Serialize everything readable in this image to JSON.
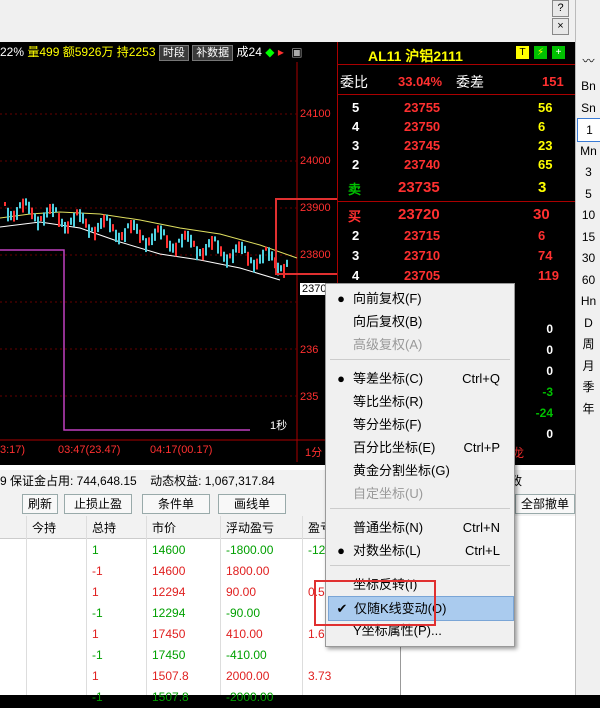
{
  "title_strip": {
    "help_btn": "?",
    "close_btn": "×"
  },
  "info_bar": {
    "pct": "22%",
    "volume": "量499",
    "amount": "额5926万",
    "hold": "持2253",
    "tag_period": "时段",
    "tag_supplement": "补数据",
    "suffix": "成24"
  },
  "chart": {
    "price_labels": [
      "24100",
      "24000",
      "23900",
      "23800",
      "2370",
      "236",
      "235"
    ],
    "time_labels": [
      "3:17)",
      "03:47(23.47)",
      "04:17(00.17)",
      "1分"
    ],
    "cursor_label": "1秒"
  },
  "orderbook": {
    "symbol": "AL11 沪铝2111",
    "commission_ratio_label": "委比",
    "commission_ratio": "33.04%",
    "commission_diff_label": "委差",
    "commission_diff": "151",
    "sell_rows": [
      {
        "level": "5",
        "price": "23755",
        "vol": "56"
      },
      {
        "level": "4",
        "price": "23750",
        "vol": "6"
      },
      {
        "level": "3",
        "price": "23745",
        "vol": "23"
      },
      {
        "level": "2",
        "price": "23740",
        "vol": "65"
      }
    ],
    "sell1": {
      "label": "卖",
      "price": "23735",
      "vol": "3"
    },
    "buy1": {
      "label": "买",
      "price": "23720",
      "vol": "30"
    },
    "buy_rows": [
      {
        "level": "2",
        "price": "23715",
        "vol": "6"
      },
      {
        "level": "3",
        "price": "23710",
        "vol": "74"
      },
      {
        "level": "4",
        "price": "23705",
        "vol": "119"
      }
    ],
    "right_values": [
      "0",
      "0",
      "0",
      "-3",
      "-24",
      "0"
    ],
    "footer": "成交龙"
  },
  "status": {
    "margin": "9  保证金占用: 744,648.15",
    "dynamic_equity": "动态权益: 1,067,317.84",
    "cancel_all": "全部撤单",
    "side_label": "致"
  },
  "buttons": [
    "刷新",
    "止损止盈",
    "条件单",
    "画线单"
  ],
  "table": {
    "headers": [
      "今持",
      "总持",
      "市价",
      "浮动盈亏",
      "盈亏"
    ],
    "rows": [
      {
        "total": "1",
        "price": "14600",
        "float_pl": "-1800.00",
        "pl": "-12",
        "color": "green"
      },
      {
        "total": "-1",
        "price": "14600",
        "float_pl": "1800.00",
        "pl": "",
        "color": "red"
      },
      {
        "total": "1",
        "price": "12294",
        "float_pl": "90.00",
        "pl": "0.5",
        "color": "red"
      },
      {
        "total": "-1",
        "price": "12294",
        "float_pl": "-90.00",
        "pl": "",
        "color": "green"
      },
      {
        "total": "1",
        "price": "17450",
        "float_pl": "410.00",
        "pl": "1.6",
        "color": "red"
      },
      {
        "total": "-1",
        "price": "17450",
        "float_pl": "-410.00",
        "pl": "",
        "color": "green"
      },
      {
        "total": "1",
        "price": "1507.8",
        "float_pl": "2000.00",
        "pl": "3.73",
        "color": "red"
      },
      {
        "total": "-1",
        "price": "1507.8",
        "float_pl": "-2000.00",
        "pl": "",
        "color": "green"
      }
    ]
  },
  "right_toolbar": [
    "Bn",
    "Sn",
    "1",
    "Mn",
    "3",
    "5",
    "10",
    "15",
    "30",
    "60",
    "Hn",
    "D",
    "周",
    "月",
    "季",
    "年"
  ],
  "context_menu": {
    "items": [
      {
        "label": "向前复权(F)",
        "shortcut": "",
        "mark": "dot",
        "disabled": false
      },
      {
        "label": "向后复权(B)",
        "shortcut": "",
        "mark": "",
        "disabled": false
      },
      {
        "label": "高级复权(A)",
        "shortcut": "",
        "mark": "",
        "disabled": true
      },
      {
        "label": "等差坐标(C)",
        "shortcut": "Ctrl+Q",
        "mark": "dot",
        "disabled": false
      },
      {
        "label": "等比坐标(R)",
        "shortcut": "",
        "mark": "",
        "disabled": false
      },
      {
        "label": "等分坐标(F)",
        "shortcut": "",
        "mark": "",
        "disabled": false
      },
      {
        "label": "百分比坐标(E)",
        "shortcut": "Ctrl+P",
        "mark": "",
        "disabled": false
      },
      {
        "label": "黄金分割坐标(G)",
        "shortcut": "",
        "mark": "",
        "disabled": false
      },
      {
        "label": "自定坐标(U)",
        "shortcut": "",
        "mark": "",
        "disabled": true
      },
      {
        "label": "普通坐标(N)",
        "shortcut": "Ctrl+N",
        "mark": "",
        "disabled": false
      },
      {
        "label": "对数坐标(L)",
        "shortcut": "Ctrl+L",
        "mark": "dot",
        "disabled": false
      },
      {
        "label": "坐标反转(I)",
        "shortcut": "",
        "mark": "",
        "disabled": false
      },
      {
        "label": "仅随K线变动(O)",
        "shortcut": "",
        "mark": "check",
        "disabled": false
      },
      {
        "label": "Y坐标属性(P)...",
        "shortcut": "",
        "mark": "",
        "disabled": false
      }
    ]
  },
  "colors": {
    "red": "#ff3030",
    "green": "#00c000",
    "yellow": "#ffff00",
    "cyan": "#00e0e0",
    "highlight_box": "#e03030"
  }
}
